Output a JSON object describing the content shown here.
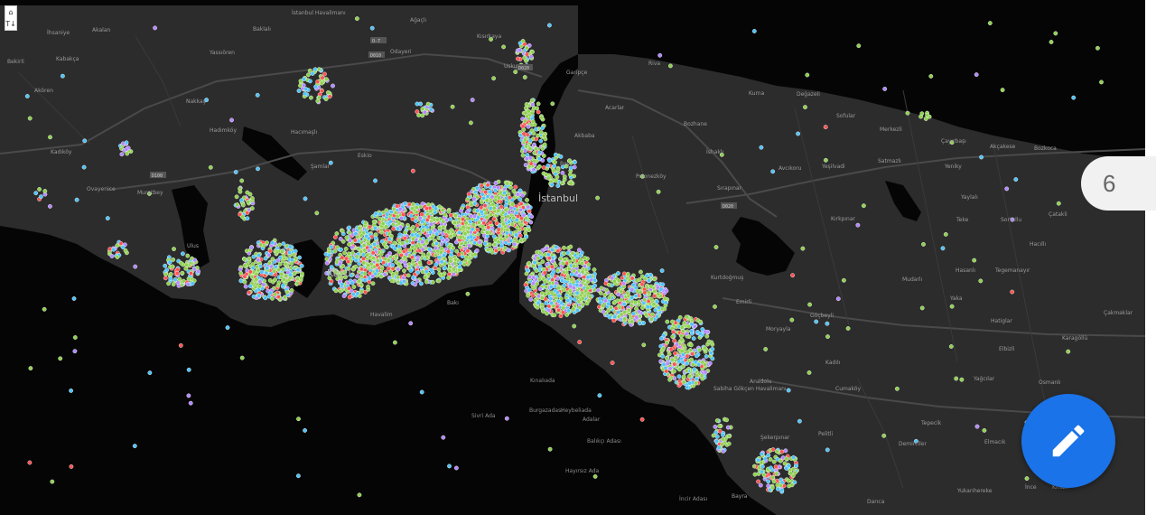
{
  "map": {
    "labels": {
      "istanbul": "İstanbul",
      "kucukcekmece": "Küçü",
      "havalim": "Havalim",
      "bakirkoy": "Bakı",
      "ihsaniye": "İhsaniye",
      "akalan": "Akalan",
      "bekirli": "Bekirli",
      "kabakca": "Kabakça",
      "akoren": "Akören",
      "ovayenice": "Ovayenice",
      "muratbey": "Muratbey",
      "kadikoy_west": "Kadıköy",
      "baklali": "Baklalı",
      "yassioren": "Yassıören",
      "nakkas": "Nakkaş",
      "hadimkoy": "Hadımköy",
      "hacimasli": "Hacımaşlı",
      "samlar": "Şamlar",
      "eskioba": "Eskio",
      "ulus": "Ulus",
      "istanbul_havalimani": "İstanbul Havalimanı",
      "agacli": "Ağaçlı",
      "kisirkaya": "Kısırkaya",
      "odayeri": "Odayeri",
      "garipce": "Garipçe",
      "uskumru": "Uskumru",
      "riva": "Riva",
      "kurna": "Kurna",
      "degazeli": "Değazeli",
      "sofular": "Sofular",
      "akbaba": "Akbaba",
      "bozhane": "Bozhane",
      "ishakli": "İshaklı",
      "polonezkoy": "Polonezköy",
      "acarlar": "Acarlar",
      "kocullu": "Koçullu",
      "beykoz": "Bey",
      "avcikoru": "Avcıkoru",
      "yesilvadi": "Yeşilvadi",
      "satmazli": "Satmazlı",
      "merkezli": "Merkezli",
      "cayirbasi": "Çayırbaşı",
      "akcakese": "Akçakese",
      "bozkoca": "Bozkoca",
      "yeniky": "Yeniky",
      "yayla": "Yaylalı",
      "sirapinar": "Sırapınar",
      "teke": "Teke",
      "sortullu": "Sortullu",
      "catakli": "Çatakli",
      "kirkpinar": "Kırkpınar",
      "hacilli": "Hacıllı",
      "hasanli": "Hasanlı",
      "tegemanayir": "Tegemanayır",
      "mudarli": "Mudarlı",
      "yaka": "Yaka",
      "kurtdogmus": "Kurtdoğmuş",
      "emirli": "Emirli",
      "gocbeyli": "Göçbeyli",
      "hatiglar": "Hatiglar",
      "cakmaklar": "Çakmaklar",
      "moryayla": "Moryayla",
      "kadirli": "Kadılı",
      "elbizli": "Elbizli",
      "karagollu": "Karagöllü",
      "cumakoy": "Cumaköy",
      "yagcilar": "Yağcılar",
      "anadolu": "Anadolu",
      "osmanli": "Osmanlı",
      "sabiha": "Sabiha Gökçen Havalimanı",
      "semse": "Şemse",
      "tepecik": "Tepecik",
      "pelitli": "Pelitli",
      "sekerpinar": "Şekerpınar",
      "demirciler": "Demirciler",
      "elmacik": "Elmacık",
      "yukarihereke": "Yukarıhereke",
      "darica": "Darıca",
      "bayramoglu": "Bayra",
      "kinaliada": "Kınalıada",
      "burgazadasi": "Burgazadası",
      "heybeliada": "Heybeliada",
      "buyukada": "Adalar",
      "sivriada": "Sivri Ada",
      "balikci": "Balıkçı Adası",
      "hayirsiz": "Hayırsız Ada",
      "incir": "İncir Adası",
      "ince": "İnce",
      "kirazli": "Kirazlı"
    },
    "roads": {
      "d010": "D010",
      "o1": "D020",
      "d100": "D100",
      "d020": "D020",
      "o7": "O-7"
    }
  },
  "controls": {
    "home_icon": "⌂",
    "layers_icon": "T↓"
  },
  "counter_badge": "6",
  "fab": {
    "icon": "pencil-icon",
    "color": "#1a73e8"
  },
  "colors": {
    "land": "#2c2c2c",
    "water": "#050505",
    "marker_green": "#8fd14f",
    "marker_blue": "#4fc3f7",
    "marker_purple": "#b388ff",
    "marker_red": "#ff5252"
  }
}
